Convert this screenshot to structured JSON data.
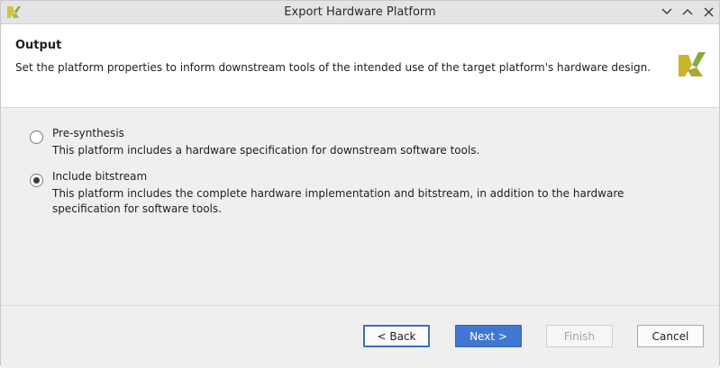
{
  "window": {
    "title": "Export Hardware Platform",
    "app_icon": "xilinx-logo-icon",
    "controls": [
      "minimize-icon",
      "maximize-icon",
      "close-icon"
    ]
  },
  "banner": {
    "heading": "Output",
    "description": "Set the platform properties to inform downstream tools of the intended use of the target platform's hardware design.",
    "logo": "xilinx-logo-icon"
  },
  "options": [
    {
      "label": "Pre-synthesis",
      "description": "This platform includes a hardware specification for downstream software tools.",
      "selected": false
    },
    {
      "label": "Include bitstream",
      "description": "This platform includes the complete hardware implementation and bitstream, in addition to the hardware specification for software tools.",
      "selected": true
    }
  ],
  "buttons": {
    "back": "< Back",
    "next": "Next >",
    "finish": "Finish",
    "cancel": "Cancel"
  },
  "colors": {
    "accent": "#3f77d2",
    "logo_yellow": "#c8b42a",
    "logo_green": "#8aa83c"
  }
}
